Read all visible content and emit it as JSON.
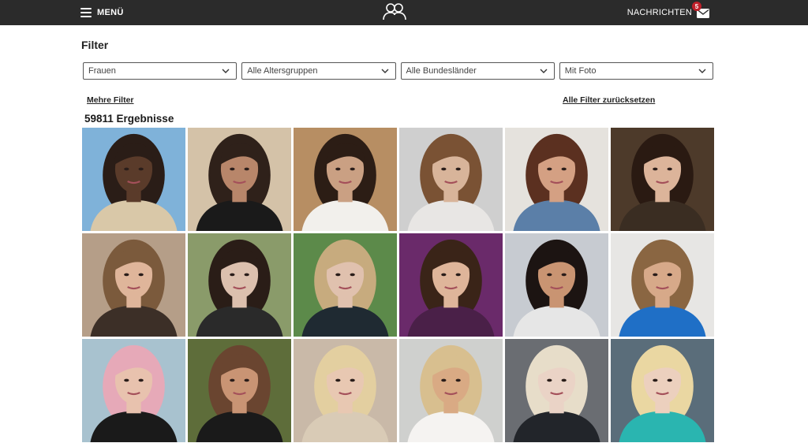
{
  "header": {
    "menu_label": "MENÜ",
    "messages_label": "NACHRICHTEN",
    "messages_badge": "5",
    "logo_icon": "couple-icon",
    "menu_icon": "hamburger-icon",
    "messages_icon": "envelope-icon",
    "background_color": "#2b2b2b",
    "badge_color": "#c0202a"
  },
  "filter": {
    "title": "Filter",
    "selects": [
      {
        "value": "Frauen"
      },
      {
        "value": "Alle Altersgruppen"
      },
      {
        "value": "Alle Bundesländer"
      },
      {
        "value": "Mit Foto"
      }
    ],
    "more_label": "Mehre Filter",
    "reset_label": "Alle Filter zurücksetzen"
  },
  "results": {
    "count_label": "59811 Ergebnisse"
  },
  "photos": [
    {
      "bg": "#7fb2d9",
      "fg": "#5a3b2a",
      "hair": "#2a1d17",
      "accent": "#d9c8a8"
    },
    {
      "bg": "#d4c2a8",
      "fg": "#b8866a",
      "hair": "#2f211a",
      "accent": "#1a1a1a"
    },
    {
      "bg": "#b78e63",
      "fg": "#caa083",
      "hair": "#2c1d15",
      "accent": "#f2f0ec"
    },
    {
      "bg": "#cfcfcf",
      "fg": "#d8b49a",
      "hair": "#7a5234",
      "accent": "#e8e6e4"
    },
    {
      "bg": "#e5e2dd",
      "fg": "#d4a083",
      "hair": "#5b3020",
      "accent": "#5b7fa8"
    },
    {
      "bg": "#4d3a2a",
      "fg": "#dcb49a",
      "hair": "#2a1a12",
      "accent": "#3a2d22"
    },
    {
      "bg": "#b59e88",
      "fg": "#dfb59a",
      "hair": "#7b5a3c",
      "accent": "#3c2f27"
    },
    {
      "bg": "#8a9b6a",
      "fg": "#dcc0ae",
      "hair": "#2a1d17",
      "accent": "#2a2a2a"
    },
    {
      "bg": "#5c8a4a",
      "fg": "#e0c1ae",
      "hair": "#c7ab7e",
      "accent": "#1f2a32"
    },
    {
      "bg": "#6a2a6a",
      "fg": "#dfb59a",
      "hair": "#3a2418",
      "accent": "#4a2048"
    },
    {
      "bg": "#c7cbd1",
      "fg": "#c99472",
      "hair": "#1c1412",
      "accent": "#e6e6e6"
    },
    {
      "bg": "#e7e6e4",
      "fg": "#d7a989",
      "hair": "#8a6642",
      "accent": "#1f6fc6"
    },
    {
      "bg": "#a8c2cf",
      "fg": "#e8c2ae",
      "hair": "#e6a9b8",
      "accent": "#1a1a1a"
    },
    {
      "bg": "#5e6d3a",
      "fg": "#c99474",
      "hair": "#6a4530",
      "accent": "#1a1a1a"
    },
    {
      "bg": "#c9b9a8",
      "fg": "#e8c8b2",
      "hair": "#e3cfa0",
      "accent": "#d9cbb6"
    },
    {
      "bg": "#cfd0ce",
      "fg": "#d9aa84",
      "hair": "#d8bf8f",
      "accent": "#f5f3f1"
    },
    {
      "bg": "#6a6d72",
      "fg": "#ead3c6",
      "hair": "#e7ddc9",
      "accent": "#22252a"
    },
    {
      "bg": "#5a6d7a",
      "fg": "#ecd0be",
      "hair": "#ead7a2",
      "accent": "#2ab5b0"
    }
  ]
}
